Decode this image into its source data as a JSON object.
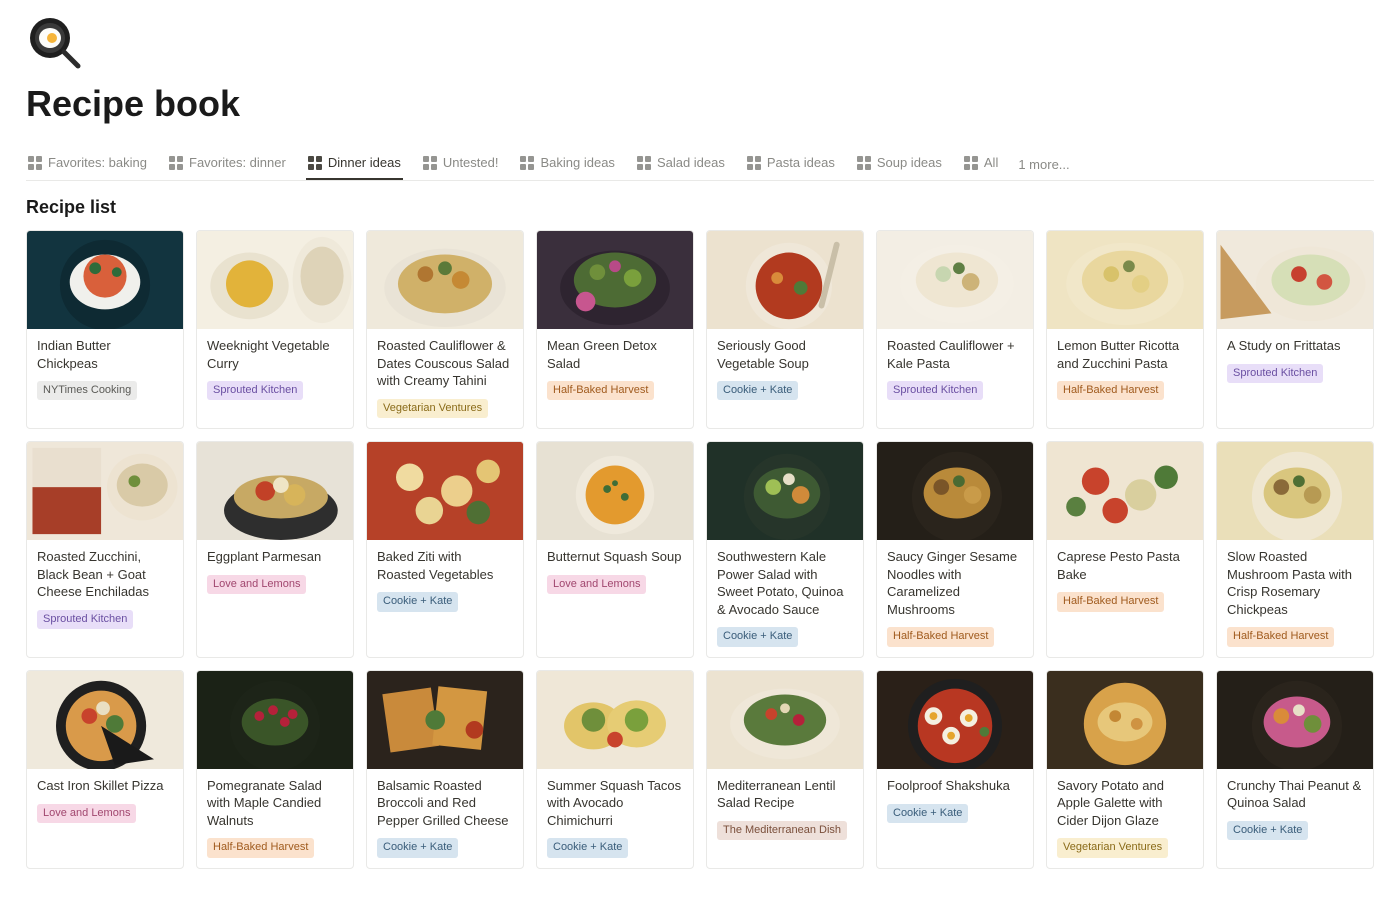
{
  "page": {
    "title": "Recipe book",
    "icon": "frying-pan-egg"
  },
  "tabs": [
    {
      "label": "Favorites: baking",
      "active": false
    },
    {
      "label": "Favorites: dinner",
      "active": false
    },
    {
      "label": "Dinner ideas",
      "active": true
    },
    {
      "label": "Untested!",
      "active": false
    },
    {
      "label": "Baking ideas",
      "active": false
    },
    {
      "label": "Salad ideas",
      "active": false
    },
    {
      "label": "Pasta ideas",
      "active": false
    },
    {
      "label": "Soup ideas",
      "active": false
    },
    {
      "label": "All",
      "active": false
    }
  ],
  "more_tabs_label": "1 more...",
  "section_title": "Recipe list",
  "tag_colors": {
    "NYTimes Cooking": "gray",
    "Sprouted Kitchen": "purple",
    "Vegetarian Ventures": "yellow",
    "Half-Baked Harvest": "orange",
    "Cookie + Kate": "blue",
    "Love and Lemons": "pink",
    "The Mediterranean Dish": "brown"
  },
  "recipes": [
    {
      "title": "Indian Butter Chickpeas",
      "tag": "NYTimes Cooking",
      "cover": "dark-curry"
    },
    {
      "title": "Weeknight Vegetable Curry",
      "tag": "Sprouted Kitchen",
      "cover": "yellow-curry"
    },
    {
      "title": "Roasted Cauliflower & Dates Couscous Salad with Creamy Tahini",
      "tag": "Vegetarian Ventures",
      "cover": "couscous"
    },
    {
      "title": "Mean Green Detox Salad",
      "tag": "Half-Baked Harvest",
      "cover": "green-salad"
    },
    {
      "title": "Seriously Good Vegetable Soup",
      "tag": "Cookie + Kate",
      "cover": "red-soup"
    },
    {
      "title": "Roasted Cauliflower + Kale Pasta",
      "tag": "Sprouted Kitchen",
      "cover": "white-pasta"
    },
    {
      "title": "Lemon Butter Ricotta and Zucchini Pasta",
      "tag": "Half-Baked Harvest",
      "cover": "cream-pasta"
    },
    {
      "title": "A Study on Frittatas",
      "tag": "Sprouted Kitchen",
      "cover": "frittata"
    },
    {
      "title": "Roasted Zucchini, Black Bean + Goat Cheese Enchiladas",
      "tag": "Sprouted Kitchen",
      "cover": "enchiladas"
    },
    {
      "title": "Eggplant Parmesan",
      "tag": "Love and Lemons",
      "cover": "eggplant"
    },
    {
      "title": "Baked Ziti with Roasted Vegetables",
      "tag": "Cookie + Kate",
      "cover": "baked-ziti"
    },
    {
      "title": "Butternut Squash Soup",
      "tag": "Love and Lemons",
      "cover": "orange-soup"
    },
    {
      "title": "Southwestern Kale Power Salad with Sweet Potato, Quinoa & Avocado Sauce",
      "tag": "Cookie + Kate",
      "cover": "kale-bowl"
    },
    {
      "title": "Saucy Ginger Sesame Noodles with Caramelized Mushrooms",
      "tag": "Half-Baked Harvest",
      "cover": "sesame-noodles"
    },
    {
      "title": "Caprese Pesto Pasta Bake",
      "tag": "Half-Baked Harvest",
      "cover": "caprese"
    },
    {
      "title": "Slow Roasted Mushroom Pasta with Crisp Rosemary Chickpeas",
      "tag": "Half-Baked Harvest",
      "cover": "mushroom-pasta"
    },
    {
      "title": "Cast Iron Skillet Pizza",
      "tag": "Love and Lemons",
      "cover": "pizza"
    },
    {
      "title": "Pomegranate Salad with Maple Candied Walnuts",
      "tag": "Half-Baked Harvest",
      "cover": "pomegranate"
    },
    {
      "title": "Balsamic Roasted Broccoli and Red Pepper Grilled Cheese",
      "tag": "Cookie + Kate",
      "cover": "grilled-cheese"
    },
    {
      "title": "Summer Squash Tacos with Avocado Chimichurri",
      "tag": "Cookie + Kate",
      "cover": "tacos"
    },
    {
      "title": "Mediterranean Lentil Salad Recipe",
      "tag": "The Mediterranean Dish",
      "cover": "lentil"
    },
    {
      "title": "Foolproof Shakshuka",
      "tag": "Cookie + Kate",
      "cover": "shakshuka"
    },
    {
      "title": "Savory Potato and Apple Galette with Cider Dijon Glaze",
      "tag": "Vegetarian Ventures",
      "cover": "galette"
    },
    {
      "title": "Crunchy Thai Peanut & Quinoa Salad",
      "tag": "Cookie + Kate",
      "cover": "thai-salad"
    }
  ]
}
